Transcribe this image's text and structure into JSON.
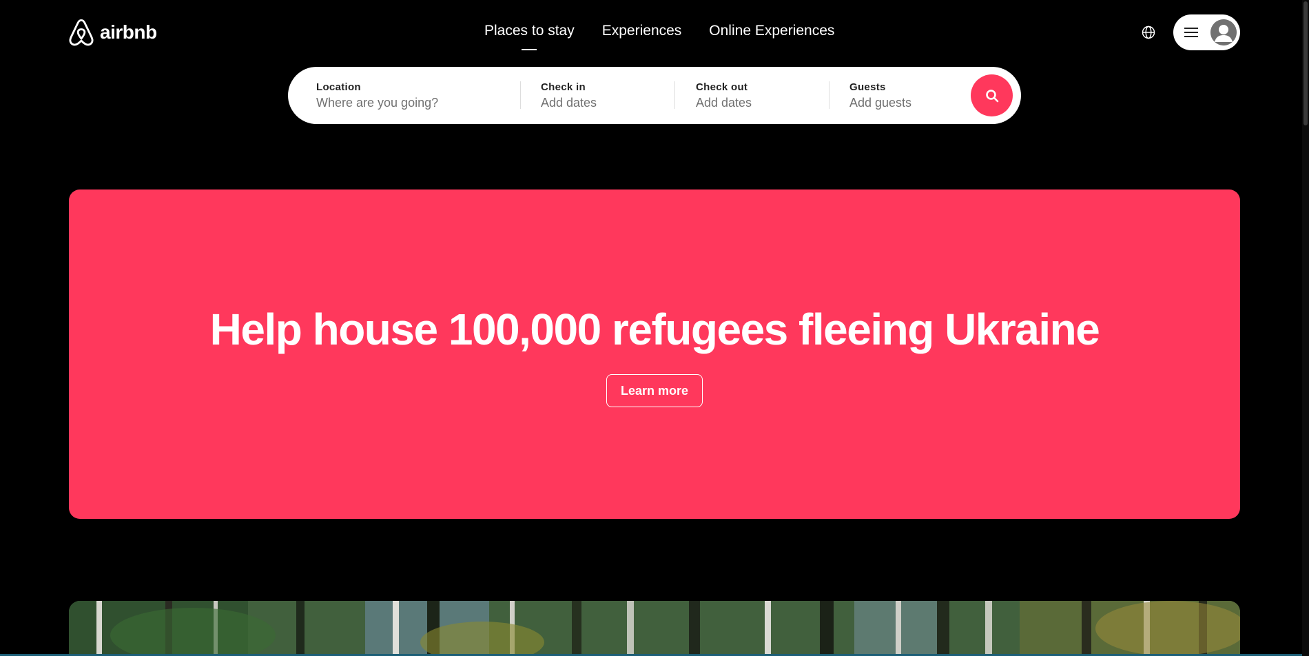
{
  "brand": {
    "name": "airbnb",
    "accent_color": "#ff385c"
  },
  "nav": {
    "tabs": [
      {
        "label": "Places to stay",
        "active": true
      },
      {
        "label": "Experiences",
        "active": false
      },
      {
        "label": "Online Experiences",
        "active": false
      }
    ]
  },
  "header_icons": {
    "language": "globe-icon",
    "menu": "hamburger-icon",
    "profile": "avatar-icon"
  },
  "search": {
    "location": {
      "label": "Location",
      "placeholder": "Where are you going?"
    },
    "check_in": {
      "label": "Check in",
      "placeholder": "Add dates"
    },
    "check_out": {
      "label": "Check out",
      "placeholder": "Add dates"
    },
    "guests": {
      "label": "Guests",
      "placeholder": "Add guests"
    },
    "button_icon": "search-icon"
  },
  "banner": {
    "title": "Help house 100,000 refugees fleeing Ukraine",
    "button_label": "Learn more",
    "background_color": "#ff385c"
  }
}
